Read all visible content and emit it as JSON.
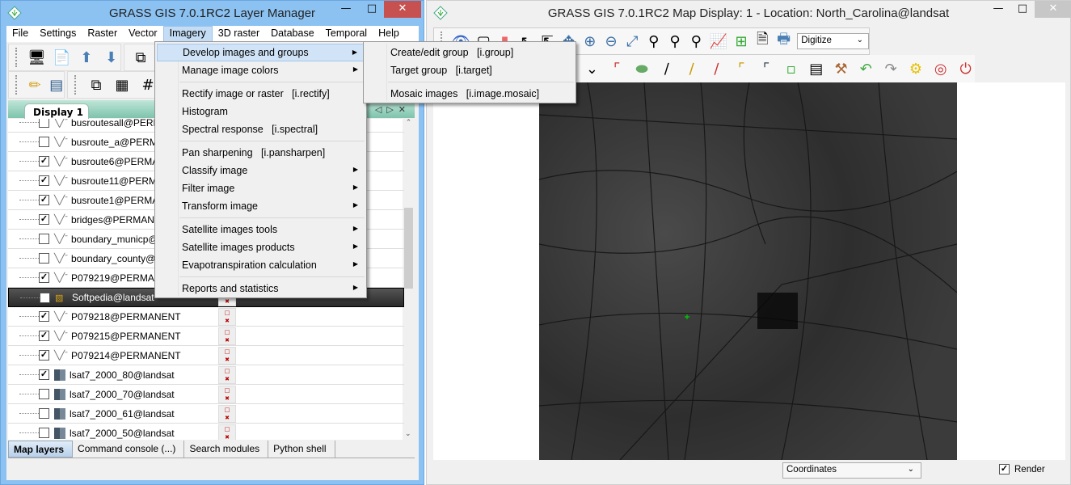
{
  "layer_manager": {
    "title": "GRASS GIS 7.0.1RC2 Layer Manager",
    "menu": [
      "File",
      "Settings",
      "Raster",
      "Vector",
      "Imagery",
      "3D raster",
      "Database",
      "Temporal",
      "Help"
    ],
    "active_menu": "Imagery",
    "display_tab": "Display 1",
    "layers": [
      {
        "name": "busroutesall@PERMANENT",
        "checked": false,
        "type": "vector"
      },
      {
        "name": "busroute_a@PERMANENT",
        "checked": false,
        "type": "vector"
      },
      {
        "name": "busroute6@PERMANENT",
        "checked": true,
        "type": "vector"
      },
      {
        "name": "busroute11@PERMANENT",
        "checked": true,
        "type": "vector"
      },
      {
        "name": "busroute1@PERMANENT",
        "checked": true,
        "type": "vector"
      },
      {
        "name": "bridges@PERMANENT",
        "checked": true,
        "type": "vector"
      },
      {
        "name": "boundary_municp@PERMANENT",
        "checked": false,
        "type": "vector"
      },
      {
        "name": "boundary_county@PERMANENT",
        "checked": false,
        "type": "vector"
      },
      {
        "name": "P079219@PERMANENT",
        "checked": true,
        "type": "vector"
      },
      {
        "name": "Softpedia@landsat",
        "checked": true,
        "type": "group",
        "selected": true
      },
      {
        "name": "P079218@PERMANENT",
        "checked": true,
        "type": "vector"
      },
      {
        "name": "P079215@PERMANENT",
        "checked": true,
        "type": "vector"
      },
      {
        "name": "P079214@PERMANENT",
        "checked": true,
        "type": "vector"
      },
      {
        "name": "lsat7_2000_80@landsat",
        "checked": true,
        "type": "raster"
      },
      {
        "name": "lsat7_2000_70@landsat",
        "checked": false,
        "type": "raster"
      },
      {
        "name": "lsat7_2000_61@landsat",
        "checked": false,
        "type": "raster"
      },
      {
        "name": "lsat7_2000_50@landsat",
        "checked": false,
        "type": "raster"
      }
    ],
    "bottom_tabs": [
      "Map layers",
      "Command console (...)",
      "Search modules",
      "Python shell"
    ]
  },
  "imagery_menu": [
    {
      "label": "Develop images and groups",
      "submenu": true,
      "highlight": true
    },
    {
      "label": "Manage image colors",
      "submenu": true
    },
    {
      "sep": true
    },
    {
      "label": "Rectify image or raster   [i.rectify]"
    },
    {
      "label": "Histogram"
    },
    {
      "label": "Spectral response   [i.spectral]"
    },
    {
      "sep": true
    },
    {
      "label": "Pan sharpening   [i.pansharpen]"
    },
    {
      "label": "Classify image",
      "submenu": true
    },
    {
      "label": "Filter image",
      "submenu": true
    },
    {
      "label": "Transform image",
      "submenu": true
    },
    {
      "sep": true
    },
    {
      "label": "Satellite images tools",
      "submenu": true
    },
    {
      "label": "Satellite images products",
      "submenu": true
    },
    {
      "label": "Evapotranspiration calculation",
      "submenu": true
    },
    {
      "sep": true
    },
    {
      "label": "Reports and statistics",
      "submenu": true
    }
  ],
  "develop_submenu": [
    {
      "label": "Create/edit group   [i.group]"
    },
    {
      "label": "Target group   [i.target]"
    },
    {
      "sep": true
    },
    {
      "label": "Mosaic images   [i.image.mosaic]"
    }
  ],
  "map_display": {
    "title": "GRASS GIS 7.0.1RC2 Map Display: 1  - Location: North_Carolina@landsat",
    "mode_select": "Digitize",
    "coords_select": "Coordinates",
    "render_label": "Render",
    "render_checked": true
  }
}
